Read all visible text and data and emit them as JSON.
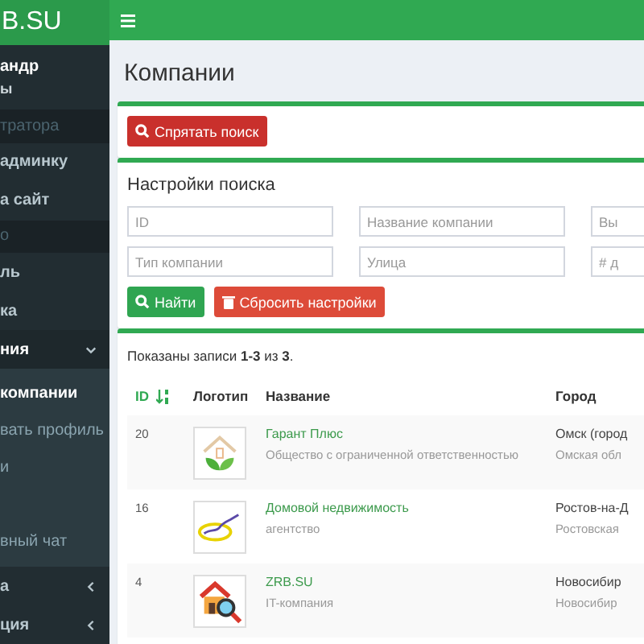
{
  "sidebar": {
    "logo": "B.SU",
    "user_name": "андр",
    "user_status": "ы",
    "items": [
      {
        "kind": "header",
        "label": "тратора"
      },
      {
        "kind": "link",
        "label": "админку"
      },
      {
        "kind": "link",
        "label": "а сайт"
      },
      {
        "kind": "header",
        "label": "о"
      },
      {
        "kind": "link",
        "label": "ль"
      },
      {
        "kind": "link",
        "label": "ка"
      },
      {
        "kind": "group",
        "label": "ния",
        "expanded": true,
        "children": [
          {
            "label": "компании",
            "selected": true
          },
          {
            "label": "вать профиль",
            "selected": false
          },
          {
            "label": "и",
            "selected": false
          },
          {
            "selected": false
          },
          {
            "label": "вный чат",
            "selected": false
          }
        ]
      },
      {
        "kind": "group",
        "label": "а",
        "expanded": false
      },
      {
        "kind": "group",
        "label": "ция",
        "expanded": false
      }
    ]
  },
  "page_title": "Компании",
  "toggle_button": "Спрятать поиск",
  "search": {
    "title": "Настройки поиска",
    "fields": [
      {
        "placeholder": "ID"
      },
      {
        "placeholder": "Название компании"
      },
      {
        "placeholder": "Вы"
      },
      {
        "placeholder": "Тип компании"
      },
      {
        "placeholder": "Улица"
      },
      {
        "placeholder": "# д"
      }
    ],
    "buttons": [
      {
        "kind": "success",
        "label": "Найти"
      },
      {
        "kind": "danger",
        "label": "Сбросить настройки"
      }
    ]
  },
  "results": {
    "summary": "Показаны записи **1-3** из **3**.",
    "columns": [
      {
        "label": "ID",
        "sorted": true
      },
      {
        "label": "Логотип",
        "sorted": false
      },
      {
        "label": "Название",
        "sorted": false
      },
      {
        "label": "Город",
        "sorted": false
      }
    ],
    "rows": [
      {
        "id": "20",
        "name": "Гарант Плюс",
        "type": "Общество с ограниченной ответственностью",
        "city": "Омск (город",
        "region": "Омская обл"
      },
      {
        "id": "16",
        "name": "Домовой недвижимость",
        "type": "агентство",
        "city": "Ростов-на-Д",
        "region": "Ростовская"
      },
      {
        "id": "4",
        "name": "ZRB.SU",
        "type": "IT-компания",
        "city": "Новосибир",
        "region": "Новосибир"
      }
    ]
  }
}
